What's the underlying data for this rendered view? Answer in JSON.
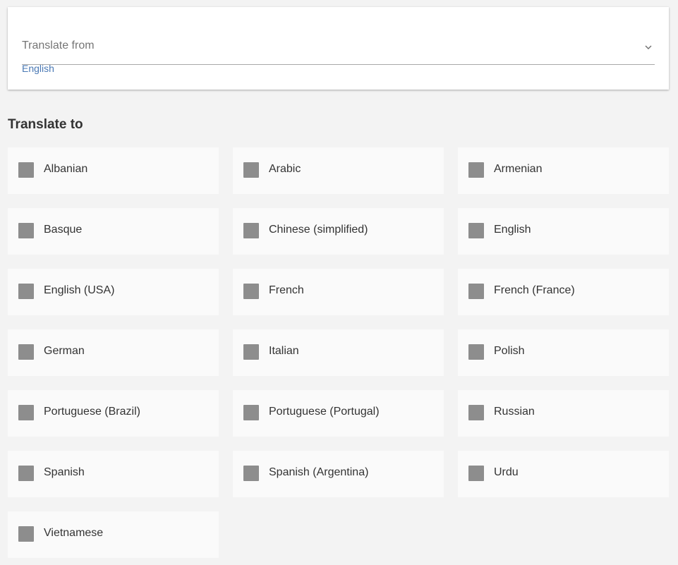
{
  "translate_from": {
    "placeholder": "Translate from",
    "selected": "English"
  },
  "translate_to": {
    "title": "Translate to",
    "languages": [
      {
        "label": "Albanian",
        "checked": false
      },
      {
        "label": "Arabic",
        "checked": false
      },
      {
        "label": "Armenian",
        "checked": false
      },
      {
        "label": "Basque",
        "checked": false
      },
      {
        "label": "Chinese (simplified)",
        "checked": false
      },
      {
        "label": "English",
        "checked": false
      },
      {
        "label": "English (USA)",
        "checked": false
      },
      {
        "label": "French",
        "checked": false
      },
      {
        "label": "French (France)",
        "checked": false
      },
      {
        "label": "German",
        "checked": false
      },
      {
        "label": "Italian",
        "checked": false
      },
      {
        "label": "Polish",
        "checked": false
      },
      {
        "label": "Portuguese (Brazil)",
        "checked": false
      },
      {
        "label": "Portuguese (Portugal)",
        "checked": false
      },
      {
        "label": "Russian",
        "checked": false
      },
      {
        "label": "Spanish",
        "checked": false
      },
      {
        "label": "Spanish (Argentina)",
        "checked": false
      },
      {
        "label": "Urdu",
        "checked": false
      },
      {
        "label": "Vietnamese",
        "checked": false
      }
    ]
  },
  "colors": {
    "accent": "#4a79b5",
    "checkbox": "#8d8d8d",
    "background": "#f3f3f3",
    "card": "#ffffff",
    "item": "#fafafa"
  },
  "icons": {
    "dropdown": "chevron-down-icon",
    "checkbox": "checkbox-icon"
  }
}
